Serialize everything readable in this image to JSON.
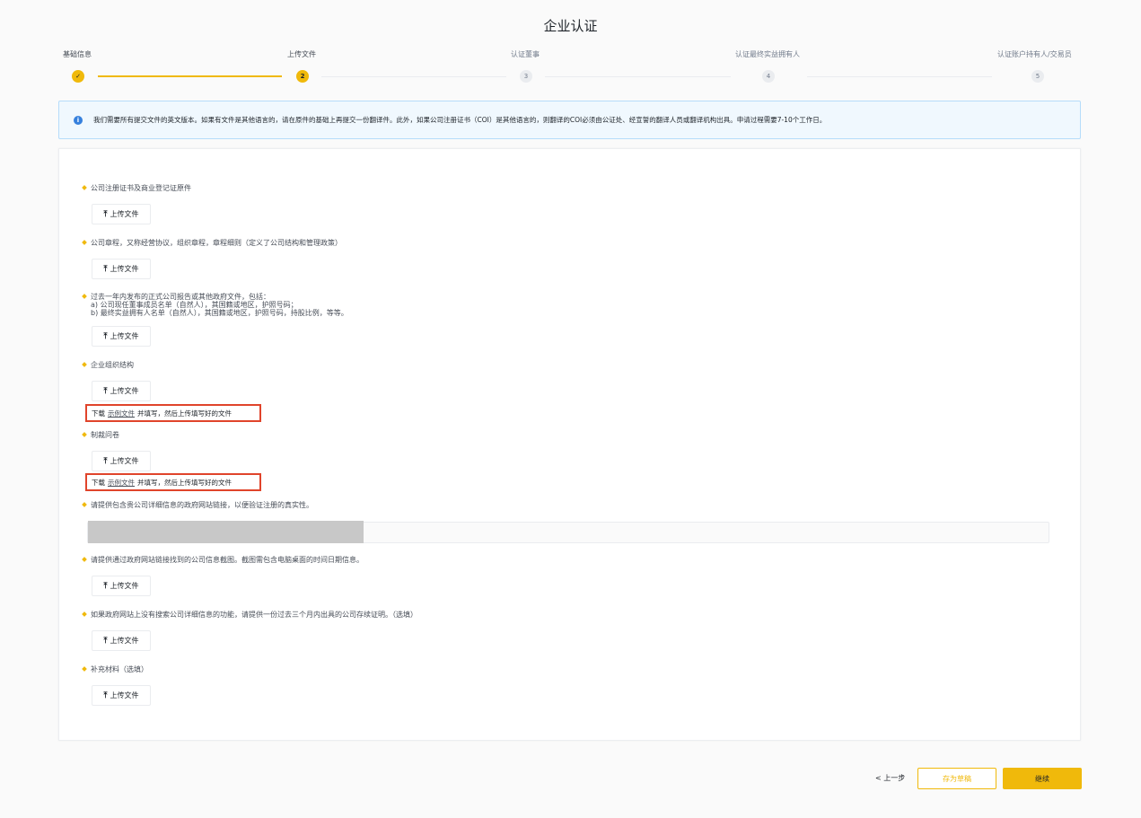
{
  "page": {
    "title": "企业认证"
  },
  "steps": [
    {
      "label": "基础信息",
      "status": "done",
      "marker": "✓"
    },
    {
      "label": "上传文件",
      "status": "current",
      "marker": "2"
    },
    {
      "label": "认证董事",
      "status": "pending",
      "marker": "3"
    },
    {
      "label": "认证最终实益拥有人",
      "status": "pending",
      "marker": "4"
    },
    {
      "label": "认证账户持有人/交易员",
      "status": "pending",
      "marker": "5"
    }
  ],
  "notice": {
    "icon": "info-icon",
    "text": "我们需要所有提交文件的英文版本。如果有文件是其他语言的，请在原件的基础上再提交一份翻译件。此外，如果公司注册证书（COI）是其他语言的，则翻译的COI必须由公证处、经宣誓的翻译人员或翻译机构出具。申请过程需要7-10个工作日。"
  },
  "upload": {
    "button_label": "上传文件",
    "icon": "upload-icon"
  },
  "sample": {
    "prefix": "下载",
    "link": "示例文件",
    "suffix": "并填写，然后上传填写好的文件"
  },
  "fields": {
    "coi": "公司注册证书及商业登记证原件",
    "articles": "公司章程，又称经营协议，组织章程，章程细则（定义了公司结构和管理政策）",
    "report_line1": "过去一年内发布的正式公司报告或其他政府文件，包括：",
    "report_line2": "a) 公司现任董事成员名单（自然人），其国籍或地区，护照号码；",
    "report_line3": "b) 最终实益拥有人名单（自然人），其国籍或地区，护照号码，持股比例，等等。",
    "org_structure": "企业组织结构",
    "sanctions": "制裁问卷",
    "gov_link": "请提供包含贵公司详细信息的政府网站链接，以便验证注册的真实性。",
    "gov_screenshot": "请提供通过政府网站链接找到的公司信息截图。截图需包含电脑桌面的时间日期信息。",
    "good_standing": "如果政府网站上没有搜索公司详细信息的功能，请提供一份过去三个月内出具的公司存续证明。（选填）",
    "supplementary": "补充材料（选填）"
  },
  "gov_link_input": {
    "value": ""
  },
  "footer": {
    "prev": "< 上一步",
    "draft": "存为草稿",
    "continue": "继续"
  },
  "colors": {
    "accent": "#f0b90b",
    "highlight_border": "#e0442b",
    "info": "#3680dd"
  }
}
